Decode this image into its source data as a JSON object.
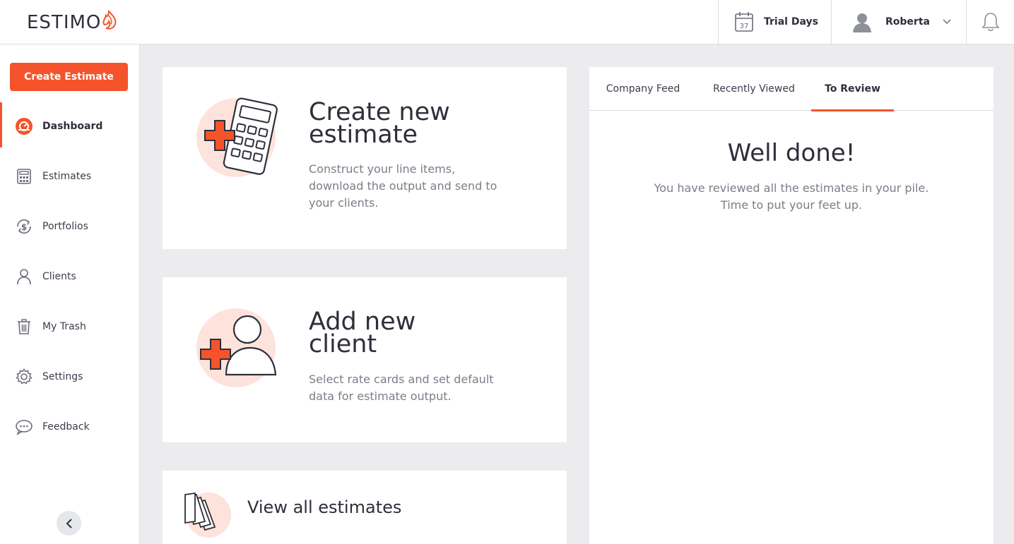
{
  "brand": {
    "name": "ESTIMO",
    "accent": "#f5532b"
  },
  "header": {
    "trial_label": "Trial Days",
    "trial_days": "37",
    "user_name": "Roberta"
  },
  "sidebar": {
    "create_button": "Create Estimate",
    "items": [
      {
        "label": "Dashboard",
        "icon": "dashboard-icon",
        "active": true
      },
      {
        "label": "Estimates",
        "icon": "calculator-icon"
      },
      {
        "label": "Portfolios",
        "icon": "portfolio-icon"
      },
      {
        "label": "Clients",
        "icon": "user-icon"
      },
      {
        "label": "My Trash",
        "icon": "trash-icon"
      },
      {
        "label": "Settings",
        "icon": "gear-icon"
      },
      {
        "label": "Feedback",
        "icon": "chat-icon"
      }
    ]
  },
  "cards": {
    "new_estimate": {
      "title_line1": "Create new",
      "title_line2": "estimate",
      "desc_line1": "Construct your line items,",
      "desc_line2": "download the output and send to",
      "desc_line3": "your clients."
    },
    "new_client": {
      "title_line1": "Add new",
      "title_line2": "client",
      "desc_line1": "Select rate cards and set default",
      "desc_line2": "data for estimate output."
    },
    "view_all": {
      "title": "View all estimates"
    }
  },
  "panel": {
    "tabs": [
      {
        "label": "Company Feed"
      },
      {
        "label": "Recently Viewed"
      },
      {
        "label": "To Review",
        "active": true
      }
    ],
    "title": "Well done!",
    "message_line1": "You have reviewed all the estimates in your pile.",
    "message_line2": "Time to put your feet up."
  }
}
